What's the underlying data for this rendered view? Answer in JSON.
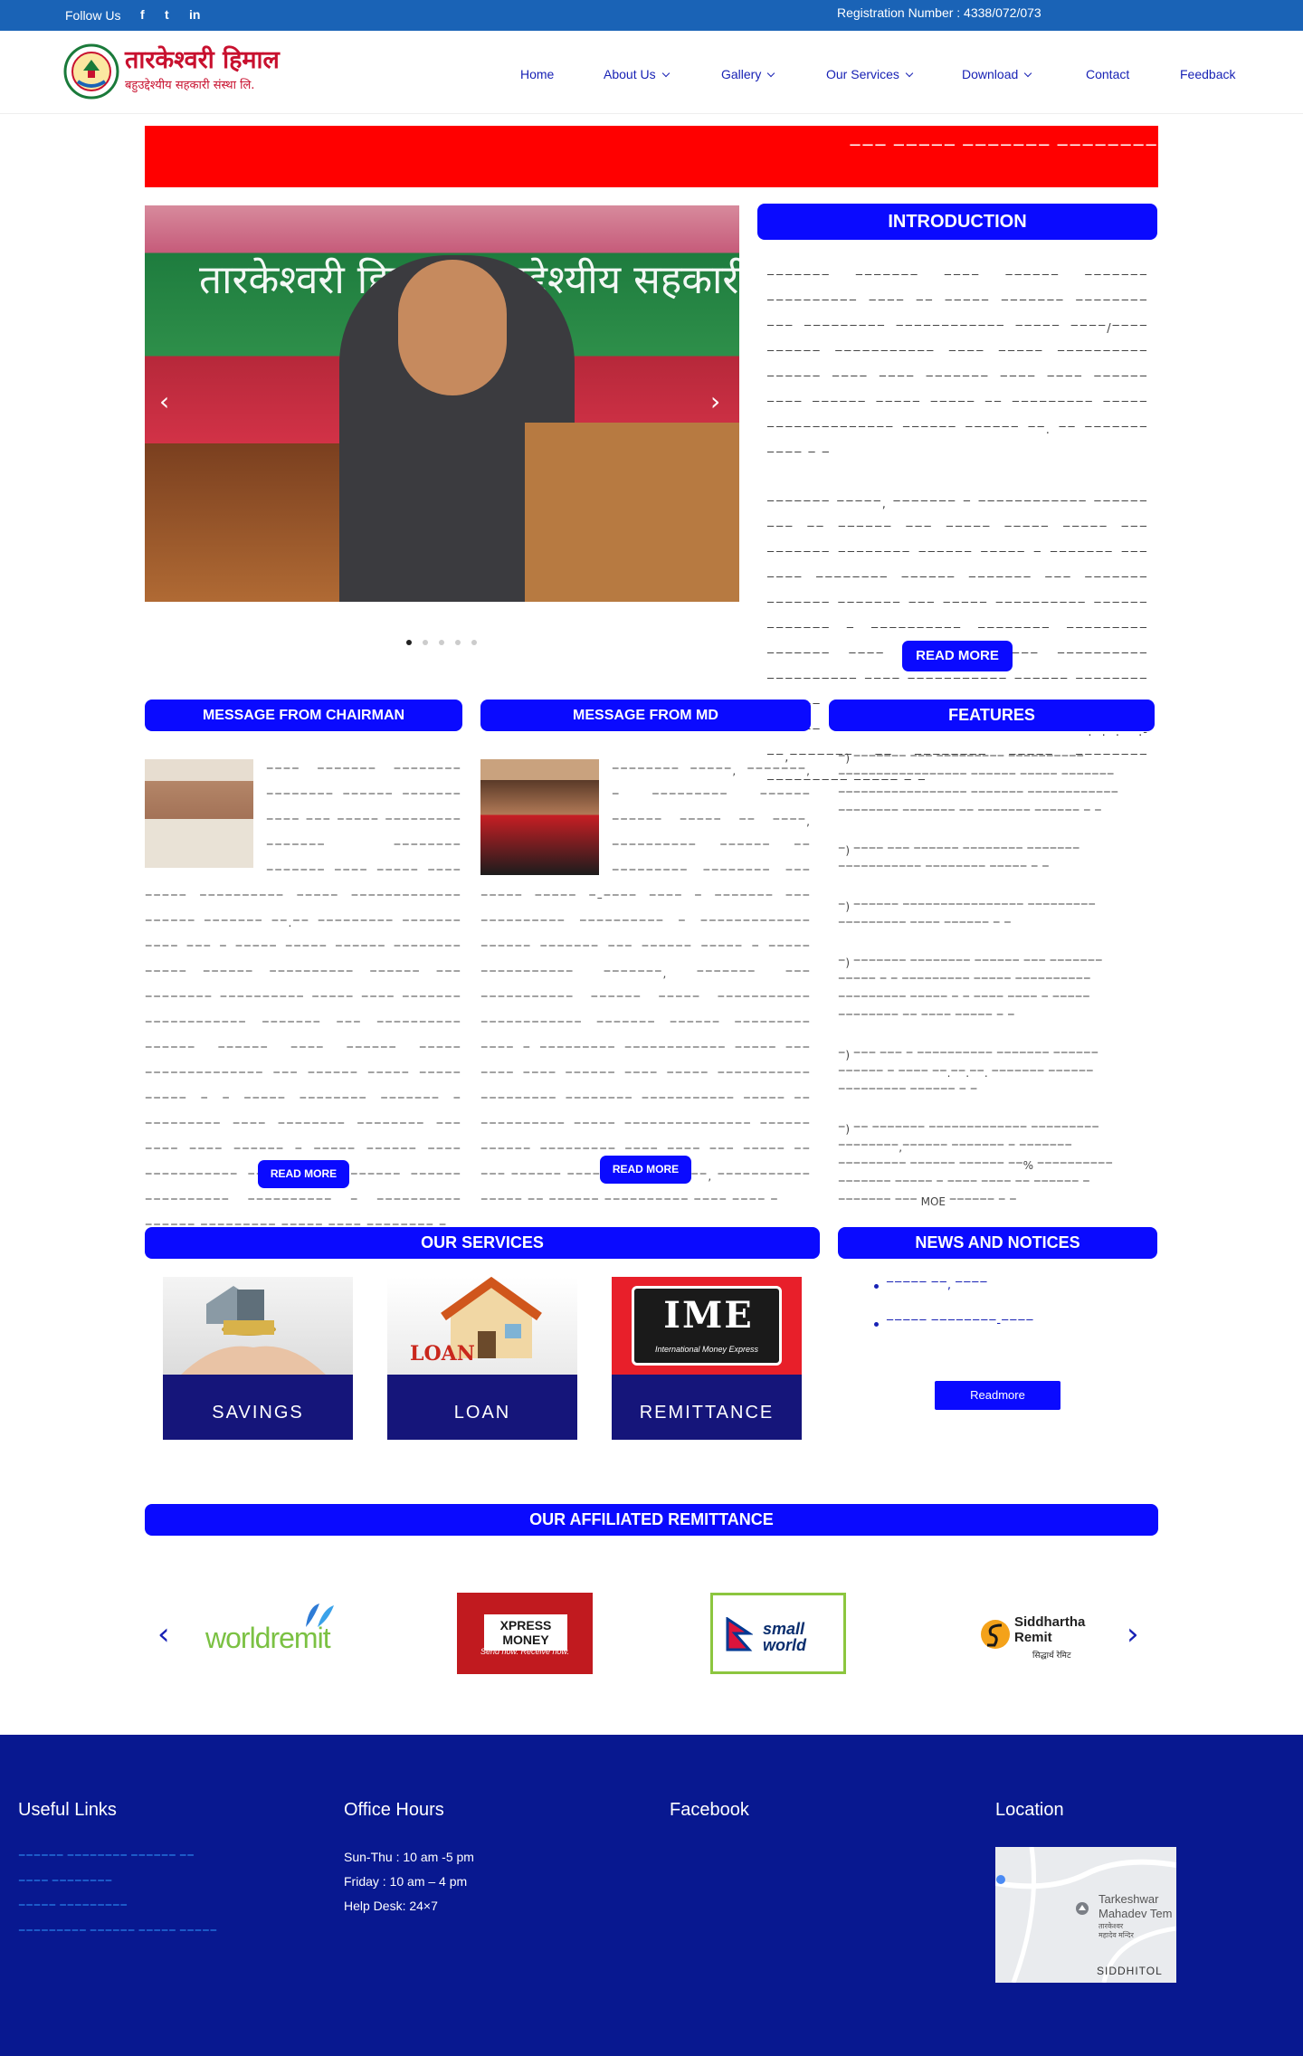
{
  "topbar": {
    "follow_label": "Follow Us",
    "social": [
      "facebook-icon",
      "twitter-icon",
      "linkedin-icon"
    ],
    "social_glyphs": [
      "f",
      "t",
      "in"
    ],
    "registration": "Registration Number : 4338/072/073"
  },
  "logo": {
    "title": "तारकेश्वरी हिमाल",
    "subtitle": "बहुउद्देश्यीय सहकारी संस्था लि."
  },
  "nav": {
    "home": "Home",
    "about": "About Us",
    "gallery": "Gallery",
    "services": "Our Services",
    "download": "Download",
    "contact": "Contact",
    "feedback": "Feedback"
  },
  "ticker": {
    "text": "ꣻꣻꣻ ꣻꣻꣻꣻꣻ ꣻꣻꣻꣻꣻꣻꣻ ꣻꣻꣻꣻꣻꣻꣻꣻꣻ ꣻꣻꣻꣻ ꣻꣻꣻꣻꣻꣻ"
  },
  "slider": {
    "banner_text": "तारकेश्वरी हिमाल बहुउद्देश्यीय सहकारी संस्था लि.",
    "slides": 5,
    "active_slide": 1
  },
  "intro": {
    "title": "INTRODUCTION",
    "para1": "ꣻꣻꣻꣻꣻꣻꣻ ꣻꣻꣻꣻꣻꣻꣻ ꣻꣻꣻꣻ ꣻꣻꣻꣻꣻꣻ ꣻꣻꣻꣻꣻꣻꣻ ꣻꣻꣻꣻꣻꣻꣻꣻꣻꣻ ꣻꣻꣻꣻ ꣻꣻ ꣻꣻꣻꣻꣻ ꣻꣻꣻꣻꣻꣻꣻ ꣻꣻꣻꣻꣻꣻꣻꣻ ꣻꣻꣻ ꣻꣻꣻꣻꣻꣻꣻꣻꣻ ꣻꣻꣻꣻꣻꣻꣻꣻꣻꣻꣻꣻ ꣻꣻꣻꣻꣻ ꣻꣻꣻꣻ/ꣻꣻꣻꣻ ꣻꣻꣻꣻꣻꣻ ꣻꣻꣻꣻꣻꣻꣻꣻꣻꣻꣻ ꣻꣻꣻꣻ ꣻꣻꣻꣻꣻ ꣻꣻꣻꣻꣻꣻꣻꣻꣻꣻ ꣻꣻꣻꣻꣻꣻ ꣻꣻꣻꣻ ꣻꣻꣻꣻ ꣻꣻꣻꣻꣻꣻꣻ ꣻꣻꣻꣻ ꣻꣻꣻꣻ ꣻꣻꣻꣻꣻꣻ ꣻꣻꣻꣻ ꣻꣻꣻꣻꣻꣻ ꣻꣻꣻꣻꣻ ꣻꣻꣻꣻꣻ ꣻꣻ ꣻꣻꣻꣻꣻꣻꣻꣻꣻ ꣻꣻꣻꣻꣻ ꣻꣻꣻꣻꣻꣻꣻꣻꣻꣻꣻꣻꣻꣻ ꣻꣻꣻꣻꣻꣻ ꣻꣻꣻꣻꣻꣻ ꣻꣻ. ꣻꣻ ꣻꣻꣻꣻꣻꣻꣻ ꣻꣻꣻꣻ ꣻ ꣻ",
    "para2": "ꣻꣻꣻꣻꣻꣻꣻ ꣻꣻꣻꣻꣻ, ꣻꣻꣻꣻꣻꣻꣻ ꣻ ꣻꣻꣻꣻꣻꣻꣻꣻꣻꣻꣻꣻ ꣻꣻꣻꣻꣻꣻ ꣻꣻꣻ ꣻꣻ ꣻꣻꣻꣻꣻꣻ ꣻꣻꣻ ꣻꣻꣻꣻꣻ ꣻꣻꣻꣻꣻ ꣻꣻꣻꣻꣻ ꣻꣻꣻ ꣻꣻꣻꣻꣻꣻꣻ ꣻꣻꣻꣻꣻꣻꣻꣻ ꣻꣻꣻꣻꣻꣻ ꣻꣻꣻꣻꣻ ꣻ ꣻꣻꣻꣻꣻꣻꣻ ꣻꣻꣻ ꣻꣻꣻꣻ ꣻꣻꣻꣻꣻꣻꣻꣻ ꣻꣻꣻꣻꣻꣻ ꣻꣻꣻꣻꣻꣻꣻ ꣻꣻꣻ ꣻꣻꣻꣻꣻꣻꣻ ꣻꣻꣻꣻꣻꣻꣻ ꣻꣻꣻꣻꣻꣻꣻ ꣻꣻꣻ ꣻꣻꣻꣻꣻ ꣻꣻꣻꣻꣻꣻꣻꣻꣻꣻ ꣻꣻꣻꣻꣻꣻ ꣻꣻꣻꣻꣻꣻꣻ ꣻ ꣻꣻꣻꣻꣻꣻꣻꣻꣻꣻ ꣻꣻꣻꣻꣻꣻꣻꣻ ꣻꣻꣻꣻꣻꣻꣻꣻꣻ ꣻꣻꣻꣻꣻꣻꣻ ꣻꣻꣻꣻ ꣻꣻꣻꣻ ꣻꣻꣻꣻꣻꣻꣻꣻꣻ ꣻꣻꣻꣻꣻꣻꣻꣻꣻꣻ ꣻꣻꣻꣻꣻꣻꣻꣻꣻꣻ ꣻꣻꣻꣻ ꣻꣻꣻꣻꣻꣻꣻꣻꣻꣻꣻ ꣻꣻꣻꣻꣻꣻ ꣻꣻꣻꣻꣻꣻꣻꣻ ꣻꣻꣻꣻꣻꣻ ꣻꣻ ꣻꣻꣻꣻ ꣻꣻꣻꣻꣻꣻ ꣻꣻꣻꣻꣻ ꣻꣻ ꣻꣻꣻꣻꣻꣻꣻꣻꣻ ꣻꣻꣻꣻꣻꣻ ꣻꣻꣻ ꣻꣻꣻꣻꣻꣻꣻꣻꣻꣻꣻ ꣻꣻꣻꣻ ꣻꣻ.ꣻ.ꣻ.ꣻꣻ.-ꣻꣻ,ꣻꣻꣻꣻꣻꣻꣻ ꣻꣻ ꣻꣻꣻꣻꣻꣻꣻꣻ ꣻꣻꣻꣻꣻ ꣻꣻꣻꣻꣻꣻꣻꣻ ꣻꣻꣻꣻꣻꣻꣻꣻꣻ ꣻꣻꣻꣻꣻ ꣻ ꣻ",
    "read_more": "READ MORE"
  },
  "chairman": {
    "title": "MESSAGE FROM CHAIRMAN",
    "text": "ꣻꣻꣻꣻ ꣻꣻꣻꣻꣻꣻꣻ ꣻꣻꣻꣻꣻꣻꣻꣻ ꣻꣻꣻꣻꣻꣻꣻꣻ ꣻꣻꣻꣻꣻꣻ ꣻꣻꣻꣻꣻꣻꣻ ꣻꣻꣻꣻ ꣻꣻꣻ ꣻꣻꣻꣻꣻ ꣻꣻꣻꣻꣻꣻꣻꣻꣻ ꣻꣻꣻꣻꣻꣻꣻ ꣻꣻꣻꣻꣻꣻꣻꣻ ꣻꣻꣻꣻꣻꣻꣻ ꣻꣻꣻꣻ ꣻꣻꣻꣻꣻ ꣻꣻꣻꣻ ꣻꣻꣻꣻꣻ ꣻꣻꣻꣻꣻꣻꣻꣻꣻꣻ ꣻꣻꣻꣻꣻ ꣻꣻꣻꣻꣻꣻꣻꣻꣻꣻꣻꣻꣻ ꣻꣻꣻꣻꣻꣻ ꣻꣻꣻꣻꣻꣻꣻ ꣻꣻ.ꣻꣻ ꣻꣻꣻꣻꣻꣻꣻꣻꣻ ꣻꣻꣻꣻꣻꣻꣻ ꣻꣻꣻꣻ ꣻꣻꣻ ꣻ ꣻꣻꣻꣻꣻ ꣻꣻꣻꣻꣻ ꣻꣻꣻꣻꣻꣻ ꣻꣻꣻꣻꣻꣻꣻꣻ ꣻꣻꣻꣻꣻ ꣻꣻꣻꣻꣻꣻ ꣻꣻꣻꣻꣻꣻꣻꣻꣻꣻ ꣻꣻꣻꣻꣻꣻ ꣻꣻꣻ ꣻꣻꣻꣻꣻꣻꣻꣻ ꣻꣻꣻꣻꣻꣻꣻꣻꣻꣻ ꣻꣻꣻꣻꣻ ꣻꣻꣻꣻ ꣻꣻꣻꣻꣻꣻꣻ ꣻꣻꣻꣻꣻꣻꣻꣻꣻꣻꣻꣻ ꣻꣻꣻꣻꣻꣻꣻ ꣻꣻꣻ ꣻꣻꣻꣻꣻꣻꣻꣻꣻꣻ ꣻꣻꣻꣻꣻꣻ ꣻꣻꣻꣻꣻꣻ ꣻꣻꣻꣻ ꣻꣻꣻꣻꣻꣻ ꣻꣻꣻꣻꣻ ꣻꣻꣻꣻꣻꣻꣻꣻꣻꣻꣻꣻꣻꣻ ꣻꣻꣻ ꣻꣻꣻꣻꣻꣻ ꣻꣻꣻꣻꣻ ꣻꣻꣻꣻꣻ ꣻꣻꣻꣻꣻ ꣻ ꣻ ꣻꣻꣻꣻꣻ ꣻꣻꣻꣻꣻꣻꣻꣻ ꣻꣻꣻꣻꣻꣻꣻ ꣻ ꣻꣻꣻꣻꣻꣻꣻꣻꣻ ꣻꣻꣻꣻ ꣻꣻꣻꣻꣻꣻꣻꣻ ꣻꣻꣻꣻꣻꣻꣻꣻ ꣻꣻꣻ ꣻꣻꣻꣻ ꣻꣻꣻꣻ ꣻꣻꣻꣻꣻꣻ ꣻ ꣻꣻꣻꣻꣻ ꣻꣻꣻꣻꣻꣻ ꣻꣻꣻꣻ ꣻꣻꣻꣻꣻꣻꣻꣻꣻꣻꣻ ꣻꣻꣻꣻꣻꣻꣻꣻꣻꣻ ꣻꣻꣻꣻꣻꣻꣻ ꣻꣻꣻꣻꣻꣻ ꣻꣻꣻꣻꣻꣻꣻꣻꣻꣻ ꣻꣻꣻꣻꣻꣻꣻꣻꣻꣻ ꣻ ꣻꣻꣻꣻꣻꣻꣻꣻꣻꣻ ꣻꣻꣻꣻꣻꣻ ꣻꣻꣻꣻꣻꣻꣻꣻꣻ ꣻꣻꣻꣻꣻ ꣻꣻꣻꣻ ꣻꣻꣻꣻꣻꣻꣻꣻ ꣻ",
    "read_more": "READ MORE"
  },
  "md": {
    "title": "MESSAGE FROM MD",
    "text": "ꣻꣻꣻꣻꣻꣻꣻꣻ ꣻꣻꣻꣻꣻ, ꣻꣻꣻꣻꣻꣻꣻ, ꣻ ꣻꣻꣻꣻꣻꣻꣻꣻꣻ ꣻꣻꣻꣻꣻꣻ ꣻꣻꣻꣻꣻꣻ ꣻꣻꣻꣻꣻ ꣻꣻ ꣻꣻꣻꣻ, ꣻꣻꣻꣻꣻꣻꣻꣻꣻꣻ ꣻꣻꣻꣻꣻꣻ ꣻꣻ ꣻꣻꣻꣻꣻꣻꣻꣻꣻ ꣻꣻꣻꣻꣻꣻꣻꣻ ꣻꣻꣻ ꣻꣻꣻꣻꣻ ꣻꣻꣻꣻꣻ ꣻ–ꣻꣻꣻꣻ ꣻꣻꣻꣻ ꣻ ꣻꣻꣻꣻꣻꣻꣻ ꣻꣻꣻ ꣻꣻꣻꣻꣻꣻꣻꣻꣻꣻ ꣻꣻꣻꣻꣻꣻꣻꣻꣻꣻ ꣻ ꣻꣻꣻꣻꣻꣻꣻꣻꣻꣻꣻꣻꣻ ꣻꣻꣻꣻꣻꣻ ꣻꣻꣻꣻꣻꣻꣻ ꣻꣻꣻ ꣻꣻꣻꣻꣻꣻ ꣻꣻꣻꣻꣻ ꣻ ꣻꣻꣻꣻꣻ ꣻꣻꣻꣻꣻꣻꣻꣻꣻꣻꣻ ꣻꣻꣻꣻꣻꣻꣻ, ꣻꣻꣻꣻꣻꣻꣻ ꣻꣻꣻ ꣻꣻꣻꣻꣻꣻꣻꣻꣻꣻꣻ ꣻꣻꣻꣻꣻꣻ ꣻꣻꣻꣻꣻ ꣻꣻꣻꣻꣻꣻꣻꣻꣻꣻꣻ ꣻꣻꣻꣻꣻꣻꣻꣻꣻꣻꣻꣻ ꣻꣻꣻꣻꣻꣻꣻ ꣻꣻꣻꣻꣻꣻ ꣻꣻꣻꣻꣻꣻꣻꣻꣻ ꣻꣻꣻꣻ ꣻ ꣻꣻꣻꣻꣻꣻꣻꣻꣻ ꣻꣻꣻꣻꣻꣻꣻꣻꣻꣻꣻꣻ ꣻꣻꣻꣻꣻ ꣻꣻꣻ ꣻꣻꣻꣻ ꣻꣻꣻꣻ ꣻꣻꣻꣻꣻꣻ ꣻꣻꣻꣻ ꣻꣻꣻꣻꣻ ꣻꣻꣻꣻꣻꣻꣻꣻꣻꣻꣻ ꣻꣻꣻꣻꣻꣻꣻꣻꣻ ꣻꣻꣻꣻꣻꣻꣻꣻ ꣻꣻꣻꣻꣻꣻꣻꣻꣻꣻꣻ ꣻꣻꣻꣻꣻ ꣻꣻ ꣻꣻꣻꣻꣻꣻꣻꣻꣻꣻ ꣻꣻꣻꣻꣻ ꣻꣻꣻꣻꣻꣻꣻꣻꣻꣻꣻꣻꣻꣻꣻ ꣻꣻꣻꣻꣻꣻ ꣻꣻꣻꣻꣻꣻ ꣻꣻꣻꣻꣻꣻꣻꣻꣻ ꣻꣻꣻꣻ ꣻꣻꣻꣻ ꣻꣻꣻ ꣻꣻꣻꣻꣻ ꣻꣻ ꣻꣻꣻ ꣻꣻꣻꣻꣻꣻ ꣻꣻꣻꣻꣻꣻꣻ ꣻꣻꣻꣻꣻꣻꣻꣻꣻ, ꣻꣻꣻꣻꣻꣻꣻꣻꣻꣻꣻ ꣻꣻꣻꣻꣻ ꣻꣻ ꣻꣻꣻꣻꣻꣻ ꣻꣻꣻꣻꣻꣻꣻꣻꣻꣻ ꣻꣻꣻꣻ ꣻꣻꣻꣻ ꣻ",
    "read_more": "READ MORE"
  },
  "features": {
    "title": "FEATURES",
    "items": [
      "ꣻ) ꣻꣻꣻꣻꣻꣻꣻ ꣻꣻꣻ ꣻꣻꣻꣻꣻꣻꣻꣻꣻ ꣻꣻꣻꣻꣻꣻꣻꣻꣻꣻ ꣻꣻꣻꣻꣻꣻꣻꣻꣻꣻꣻꣻꣻꣻꣻꣻꣻ ꣻꣻꣻꣻꣻꣻ ꣻꣻꣻꣻꣻ ꣻꣻꣻꣻꣻꣻꣻ ꣻꣻꣻꣻꣻꣻꣻꣻꣻꣻꣻꣻꣻꣻꣻꣻꣻ ꣻꣻꣻꣻꣻꣻꣻ ꣻꣻꣻꣻꣻꣻꣻꣻꣻꣻꣻꣻ ꣻꣻꣻꣻꣻꣻꣻꣻ ꣻꣻꣻꣻꣻꣻꣻ ꣻꣻ ꣻꣻꣻꣻꣻꣻꣻ ꣻꣻꣻꣻꣻꣻ ꣻ ꣻ",
      "ꣻ) ꣻꣻꣻꣻ ꣻꣻꣻ ꣻꣻꣻꣻꣻꣻ ꣻꣻꣻꣻꣻꣻꣻꣻ ꣻꣻꣻꣻꣻꣻꣻ ꣻꣻꣻꣻꣻꣻꣻꣻꣻꣻꣻ ꣻꣻꣻꣻꣻꣻꣻꣻ ꣻꣻꣻꣻꣻ ꣻ ꣻ",
      "ꣻ) ꣻꣻꣻꣻꣻꣻ ꣻꣻꣻꣻꣻꣻꣻꣻꣻꣻꣻꣻꣻꣻꣻꣻ ꣻꣻꣻꣻꣻꣻꣻꣻꣻ ꣻꣻꣻꣻꣻꣻꣻꣻꣻ ꣻꣻꣻꣻ ꣻꣻꣻꣻꣻꣻ ꣻ ꣻ",
      "ꣻ) ꣻꣻꣻꣻꣻꣻꣻ ꣻꣻꣻꣻꣻꣻꣻꣻ ꣻꣻꣻꣻꣻꣻ ꣻꣻꣻ ꣻꣻꣻꣻꣻꣻꣻ ꣻꣻꣻꣻꣻ ꣻ ꣻ ꣻꣻꣻꣻꣻꣻꣻꣻꣻ ꣻꣻꣻꣻꣻ ꣻꣻꣻꣻꣻꣻꣻꣻꣻꣻ ꣻꣻꣻꣻꣻꣻꣻꣻꣻ ꣻꣻꣻꣻꣻ ꣻ ꣻ ꣻꣻꣻꣻ ꣻꣻꣻꣻ ꣻ ꣻꣻꣻꣻꣻ ꣻꣻꣻꣻꣻꣻꣻꣻ ꣻꣻ ꣻꣻꣻꣻ ꣻꣻꣻꣻꣻ ꣻ ꣻ",
      "ꣻ) ꣻꣻꣻ ꣻꣻꣻ ꣻ ꣻꣻꣻꣻꣻꣻꣻꣻꣻꣻ ꣻꣻꣻꣻꣻꣻꣻ ꣻꣻꣻꣻꣻꣻ ꣻꣻꣻꣻꣻꣻ ꣻ ꣻꣻꣻꣻ ꣻꣻ.ꣻꣻ.ꣻꣻ. ꣻꣻꣻꣻꣻꣻꣻ ꣻꣻꣻꣻꣻꣻ ꣻꣻꣻꣻꣻꣻꣻꣻꣻ ꣻꣻꣻꣻꣻꣻ ꣻ ꣻ",
      "ꣻ) ꣻꣻ ꣻꣻꣻꣻꣻꣻꣻ ꣻꣻꣻꣻꣻꣻꣻꣻꣻꣻꣻꣻꣻ ꣻꣻꣻꣻꣻꣻꣻꣻꣻ ꣻꣻꣻꣻꣻꣻꣻꣻ,ꣻꣻꣻꣻꣻꣻ ꣻꣻꣻꣻꣻꣻꣻ ꣻ ꣻꣻꣻꣻꣻꣻꣻ ꣻꣻꣻꣻꣻꣻꣻꣻꣻ ꣻꣻꣻꣻꣻꣻ ꣻꣻꣻꣻꣻꣻ ꣻꣻ% ꣻꣻꣻꣻꣻꣻꣻꣻꣻꣻ ꣻꣻꣻꣻꣻꣻꣻ ꣻꣻꣻꣻꣻ ꣻ ꣻꣻꣻꣻ ꣻꣻꣻꣻ ꣻꣻ ꣻꣻꣻꣻꣻꣻ ꣻ ꣻꣻꣻꣻꣻꣻꣻ ꣻꣻꣻ MOE ꣻꣻꣻꣻꣻꣻ ꣻ ꣻ"
    ]
  },
  "services": {
    "title": "OUR SERVICES",
    "items": [
      {
        "label": "SAVINGS"
      },
      {
        "label": "LOAN"
      },
      {
        "label": "REMITTANCE"
      }
    ],
    "loan_sign": "LOAN",
    "ime_logo": "IME",
    "ime_sub": "International Money Express"
  },
  "news": {
    "title": "NEWS AND NOTICES",
    "items": [
      "ꣻꣻꣻꣻꣻ ꣻꣻ, ꣻꣻꣻꣻ",
      "ꣻꣻꣻꣻꣻ ꣻꣻꣻꣻꣻꣻꣻꣻ-ꣻꣻꣻꣻ"
    ],
    "read_more": "Readmore"
  },
  "affiliated": {
    "title": "OUR AFFILIATED REMITTANCE",
    "partners": [
      "worldremit",
      "XPRESS MONEY",
      "small world",
      "Siddhartha Remit"
    ],
    "xpress_tagline": "Send now. Receive now.",
    "siddhartha_sub": "सिद्धार्थ रेमिट"
  },
  "footer": {
    "useful_links_title": "Useful Links",
    "useful_links": [
      "ꣻꣻꣻꣻꣻꣻ ꣻꣻꣻꣻꣻꣻꣻꣻ ꣻꣻꣻꣻꣻꣻ ꣻꣻ",
      "ꣻꣻꣻꣻ ꣻꣻꣻꣻꣻꣻꣻꣻ",
      "ꣻꣻꣻꣻꣻ ꣻꣻꣻꣻꣻꣻꣻꣻꣻ",
      "ꣻꣻꣻꣻꣻꣻꣻꣻꣻ ꣻꣻꣻꣻꣻꣻ ꣻꣻꣻꣻꣻ ꣻꣻꣻꣻꣻ"
    ],
    "office_title": "Office Hours",
    "office_hours": [
      "Sun-Thu : 10 am -5 pm",
      "Friday : 10 am – 4 pm",
      "Help Desk: 24×7"
    ],
    "facebook_title": "Facebook",
    "location_title": "Location",
    "map_labels": [
      "Tarkeshwar",
      "Mahadev Tem",
      "तारकेश्वर",
      "महादेव मन्दिर",
      "SIDDHITOL"
    ]
  }
}
